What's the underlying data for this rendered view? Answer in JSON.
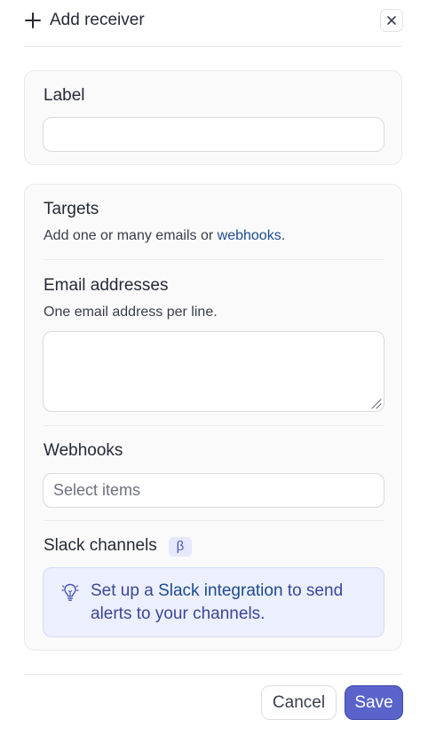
{
  "header": {
    "title": "Add receiver",
    "add_icon": "plus-icon",
    "close_icon": "close-icon"
  },
  "label_section": {
    "title": "Label",
    "value": ""
  },
  "targets": {
    "title": "Targets",
    "description_prefix": "Add one or many emails or ",
    "description_link": "webhooks",
    "description_suffix": ".",
    "email": {
      "title": "Email addresses",
      "help": "One email address per line.",
      "value": ""
    },
    "webhooks": {
      "title": "Webhooks",
      "placeholder": "Select items"
    },
    "slack": {
      "title": "Slack channels",
      "badge": "β",
      "callout_icon": "lightbulb-icon",
      "callout_prefix": "Set up a ",
      "callout_link": "Slack integration",
      "callout_suffix": " to send alerts to your channels."
    }
  },
  "footer": {
    "cancel_label": "Cancel",
    "save_label": "Save"
  },
  "colors": {
    "accent": "#5a63c9",
    "link": "#1d4b8f",
    "callout_bg": "#eceffd"
  }
}
